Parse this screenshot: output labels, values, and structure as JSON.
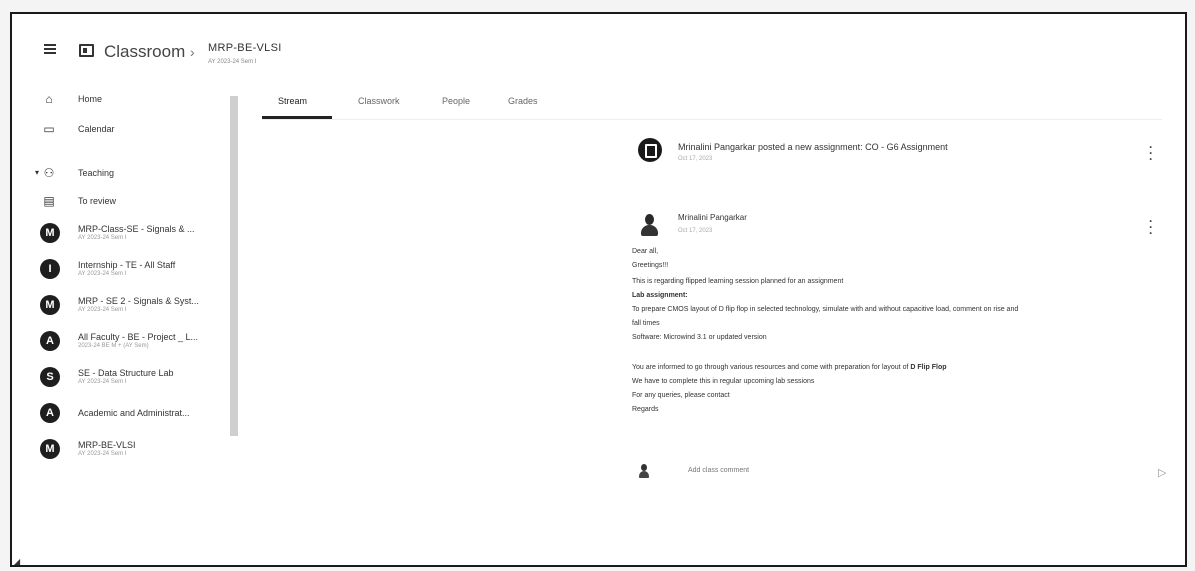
{
  "header": {
    "app_title": "Classroom",
    "breadcrumb_separator": "›",
    "class_name": "MRP-BE-VLSI",
    "class_sub": "AY 2023-24 Sem I"
  },
  "sidebar": {
    "home": "Home",
    "calendar": "Calendar",
    "teaching": "Teaching",
    "to_review": "To review",
    "classes": [
      {
        "avatar": "M",
        "name": "MRP-Class-SE - Signals & ...",
        "sub": "AY 2023-24 Sem I"
      },
      {
        "avatar": "I",
        "name": "Internship - TE - All Staff",
        "sub": "AY 2023-24 Sem I"
      },
      {
        "avatar": "M",
        "name": "MRP - SE 2 - Signals & Syst...",
        "sub": "AY 2023-24 Sem I"
      },
      {
        "avatar": "A",
        "name": "All Faculty - BE - Project _ L...",
        "sub": "2023-24 BE M + (AY Sem)"
      },
      {
        "avatar": "S",
        "name": "SE - Data Structure Lab",
        "sub": "AY 2023-24 Sem I"
      },
      {
        "avatar": "A",
        "name": "Academic and Administrat...",
        "sub": ""
      },
      {
        "avatar": "M",
        "name": "MRP-BE-VLSI",
        "sub": "AY 2023-24 Sem I"
      }
    ]
  },
  "tabs": {
    "stream": "Stream",
    "classwork": "Classwork",
    "people": "People",
    "grades": "Grades"
  },
  "post1": {
    "title": "Mrinalini Pangarkar posted a new assignment: CO - G6 Assignment",
    "date": "Oct 17, 2023"
  },
  "post2": {
    "author": "Mrinalini Pangarkar",
    "date": "Oct 17, 2023",
    "lines": {
      "l1": "Dear all,",
      "l2": "Greetings!!!",
      "l3": "This is regarding flipped learning session planned for an assignment",
      "l4": "Lab assignment:",
      "l5": "To prepare CMOS layout of D flip flop in selected technology, simulate with and without capacitive load, comment on rise and",
      "l6": "fall times",
      "l7": "Software: Microwind 3.1 or updated version",
      "l8_pre": "You are informed to go through various resources and come with preparation for layout of ",
      "l8_bold": "D Flip Flop",
      "l9": "We have to complete this in regular upcoming lab sessions",
      "l10": "For any queries, please contact",
      "l11": "Regards"
    }
  },
  "comment": {
    "placeholder": "Add class comment"
  },
  "icons": {
    "menu": "menu-icon",
    "home": "home-icon",
    "calendar": "calendar-icon",
    "teaching": "people-icon",
    "to_review": "folder-icon",
    "assignment": "assignment-icon",
    "more": "more-vert-icon",
    "send": "send-icon"
  }
}
